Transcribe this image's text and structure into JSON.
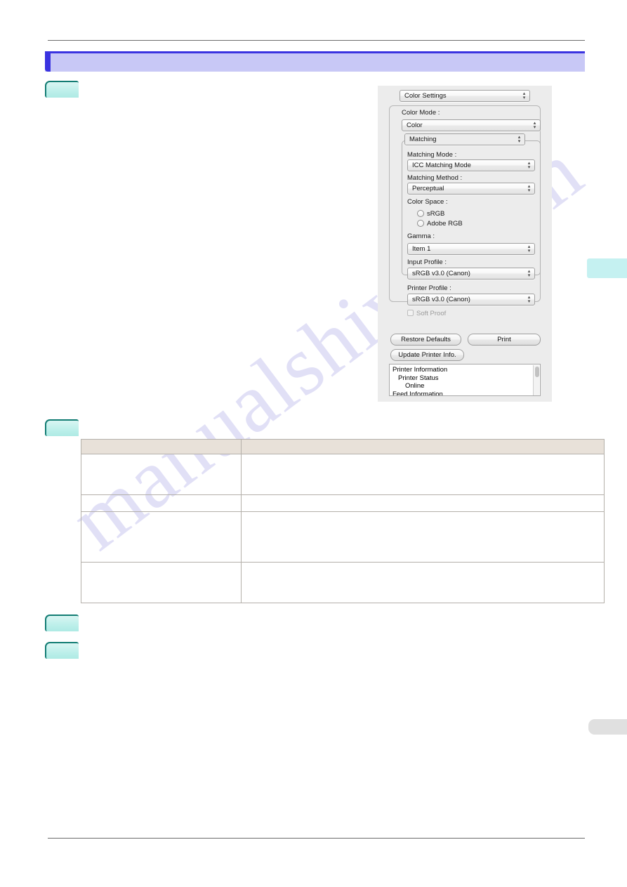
{
  "page": {
    "header_title": "",
    "steps": [
      {
        "id": "step-1",
        "label": ""
      },
      {
        "id": "step-2",
        "label": ""
      },
      {
        "id": "step-3",
        "label": ""
      },
      {
        "id": "step-4",
        "label": ""
      }
    ],
    "watermark": "manualshive.com",
    "edge_tab_cyan_label": "",
    "edge_tab_gray_label": ""
  },
  "dialog": {
    "pane_selector": {
      "value": "Color Settings",
      "icon": "updown-arrows-icon"
    },
    "color_mode": {
      "label": "Color Mode :",
      "value": "Color"
    },
    "matching_group": {
      "value": "Matching"
    },
    "matching_mode": {
      "label": "Matching Mode :",
      "value": "ICC Matching Mode"
    },
    "matching_method": {
      "label": "Matching Method :",
      "value": "Perceptual"
    },
    "color_space": {
      "label": "Color Space :",
      "options": [
        {
          "label": "sRGB",
          "selected": false
        },
        {
          "label": "Adobe RGB",
          "selected": false
        }
      ]
    },
    "gamma": {
      "label": "Gamma :",
      "value": "Item 1"
    },
    "input_profile": {
      "label": "Input Profile :",
      "value": "sRGB v3.0 (Canon)"
    },
    "printer_profile": {
      "label": "Printer Profile :",
      "value": "sRGB v3.0 (Canon)"
    },
    "soft_proof": {
      "label": "Soft Proof",
      "checked": false,
      "disabled": true
    },
    "buttons": {
      "restore_defaults": "Restore Defaults",
      "print": "Print",
      "update_printer_info": "Update Printer Info."
    },
    "printer_information": {
      "line1": "Printer Information",
      "line2": "Printer Status",
      "line3": "Online",
      "line4": "Feed Information"
    }
  },
  "table": {
    "headers": [
      "",
      ""
    ],
    "rows": [
      {
        "cells": [
          "",
          ""
        ],
        "height": 58
      },
      {
        "cells": [
          "",
          ""
        ],
        "height": 24
      },
      {
        "cells": [
          "",
          ""
        ],
        "height": 72
      },
      {
        "cells": [
          "",
          ""
        ],
        "height": 58
      }
    ]
  },
  "colors": {
    "banner_fill": "#c8c8f6",
    "banner_edge": "#3a33e0",
    "step_marker_fill": "#bcefea",
    "step_marker_border": "#127c73",
    "table_header": "#e8e1d9",
    "edge_tab_cyan": "#c5f1f1",
    "edge_tab_gray": "#e0e0e0",
    "dialog_bg": "#ececec"
  }
}
